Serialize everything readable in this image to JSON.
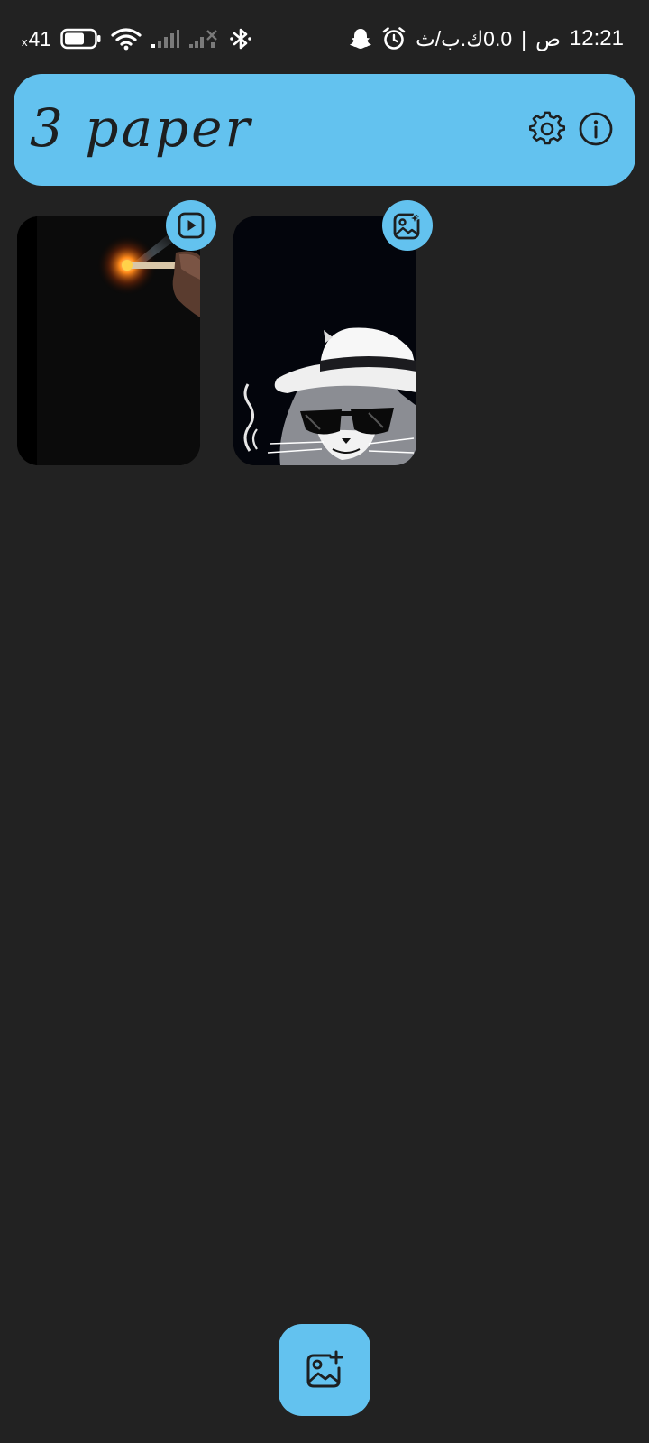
{
  "status_bar": {
    "battery_level": "41",
    "battery_prefix": "x",
    "time": "12:21",
    "am_pm": "ص",
    "separator": "|",
    "net_speed": "0.0",
    "net_unit": "ك.ب/ث",
    "icons": [
      "battery-icon",
      "wifi-icon",
      "signal-sim1-icon",
      "signal-sim2-icon",
      "bluetooth-icon",
      "snapchat-icon",
      "alarm-icon"
    ]
  },
  "header": {
    "title": "3 paper",
    "actions": [
      "settings-icon",
      "info-icon"
    ]
  },
  "wallpapers": [
    {
      "kind": "video",
      "badge_icon": "play-icon"
    },
    {
      "kind": "image",
      "badge_icon": "image-sparkle-icon"
    }
  ],
  "fab": {
    "icon": "add-image-icon"
  },
  "colors": {
    "background": "#222222",
    "accent": "#63c2ef",
    "on_accent": "#1d1f20",
    "status_text": "#ffffff"
  }
}
